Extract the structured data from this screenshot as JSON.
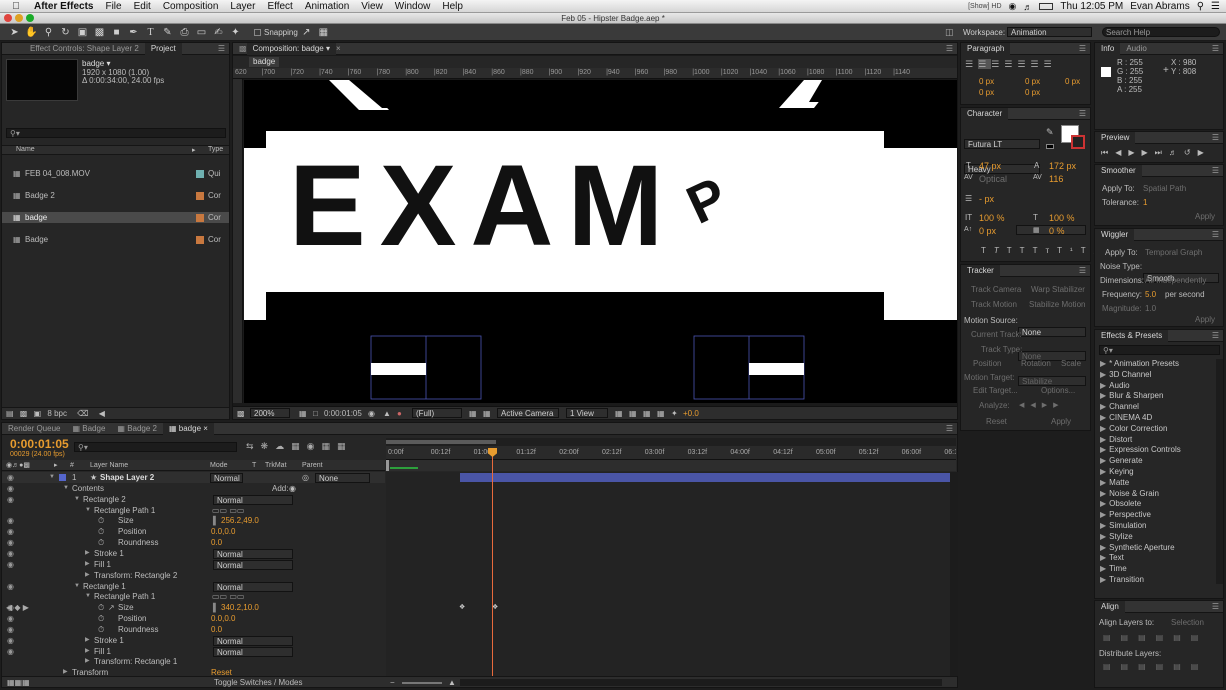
{
  "menubar": {
    "app_name": "After Effects",
    "items": [
      "File",
      "Edit",
      "Composition",
      "Layer",
      "Effect",
      "Animation",
      "View",
      "Window",
      "Help"
    ],
    "status_text": "[Show] HD",
    "clock": "Thu 12:05 PM",
    "user": "Evan Abrams"
  },
  "window_title": "Feb 05 - Hipster Badge.aep *",
  "toolbar": {
    "snapping_label": "Snapping",
    "workspace_label": "Workspace:",
    "workspace_value": "Animation",
    "search_placeholder": "Search Help"
  },
  "left_panel": {
    "tabs": [
      "Effect Controls: Shape Layer 2",
      "Project"
    ],
    "item_name": "badge ▾",
    "item_dims": "1920 x 1080 (1.00)",
    "item_duration": "Δ 0:00:34:00, 24.00 fps",
    "col_name": "Name",
    "col_type": "Type",
    "items": [
      {
        "name": "FEB 04_008.MOV",
        "type": "Qui",
        "color": "#6fb0b0"
      },
      {
        "name": "Badge 2",
        "type": "Cor",
        "color": "#c8783f"
      },
      {
        "name": "badge",
        "type": "Cor",
        "color": "#c8783f"
      },
      {
        "name": "Badge",
        "type": "Cor",
        "color": "#c8783f"
      }
    ],
    "footer_bpc": "8 bpc"
  },
  "comp_panel": {
    "tab": "Composition: badge",
    "subtab": "badge",
    "ruler_ticks": [
      "620",
      "|700",
      "|720",
      "|740",
      "|760",
      "|780",
      "|800",
      "|820",
      "|840",
      "|860",
      "|880",
      "|900",
      "|920",
      "|940",
      "|960",
      "|980",
      "|1000",
      "|1020",
      "|1040",
      "|1060",
      "|1080",
      "|1100",
      "|1120",
      "|1140"
    ],
    "badge_text": "EXAM",
    "badge_tail": "P",
    "zoom": "200%",
    "timecode": "0:00:01:05",
    "resolution": "(Full)",
    "camera": "Active Camera",
    "view": "1 View",
    "exposure": "+0.0"
  },
  "paragraph": {
    "tab": "Paragraph",
    "vals": [
      "0 px",
      "0 px",
      "0 px",
      "0 px",
      "0 px"
    ]
  },
  "character": {
    "tab": "Character",
    "font": "Futura LT",
    "style": "Heavy",
    "size": "47 px",
    "leading": "172 px",
    "kerning": "Optical",
    "tracking": "116",
    "stroke": "- px",
    "vscale": "100 %",
    "hscale": "100 %",
    "baseline": "0 px",
    "tsume": "0 %"
  },
  "tracker": {
    "tab": "Tracker",
    "track_camera": "Track Camera",
    "warp_stabilizer": "Warp Stabilizer",
    "track_motion": "Track Motion",
    "stabilize_motion": "Stabilize Motion",
    "motion_source_label": "Motion Source:",
    "motion_source": "None",
    "current_track_label": "Current Track:",
    "current_track": "None",
    "track_type_label": "Track Type:",
    "track_type": "Stabilize",
    "position": "Position",
    "rotation": "Rotation",
    "scale": "Scale",
    "motion_target": "Motion Target:",
    "edit_target": "Edit Target...",
    "options": "Options...",
    "analyze": "Analyze:",
    "reset": "Reset",
    "apply": "Apply"
  },
  "info": {
    "tabs": [
      "Info",
      "Audio"
    ],
    "r": "R : 255",
    "g": "G : 255",
    "b": "B : 255",
    "a": "A : 255",
    "x": "X : 980",
    "y": "Y : 808"
  },
  "preview": {
    "tab": "Preview"
  },
  "smoother": {
    "tab": "Smoother",
    "apply_to_label": "Apply To:",
    "apply_to": "Spatial Path",
    "tolerance_label": "Tolerance:",
    "tolerance": "1",
    "apply": "Apply"
  },
  "wiggler": {
    "tab": "Wiggler",
    "apply_to_label": "Apply To:",
    "apply_to": "Temporal Graph",
    "noise_label": "Noise Type:",
    "noise": "Smooth",
    "dim_label": "Dimensions:",
    "dim": "All Independently",
    "freq_label": "Frequency:",
    "freq": "5.0",
    "freq_unit": "per second",
    "mag_label": "Magnitude:",
    "mag": "1.0",
    "apply": "Apply"
  },
  "effects": {
    "tab": "Effects & Presets",
    "items": [
      "* Animation Presets",
      "3D Channel",
      "Audio",
      "Blur & Sharpen",
      "Channel",
      "CINEMA 4D",
      "Color Correction",
      "Distort",
      "Expression Controls",
      "Generate",
      "Keying",
      "Matte",
      "Noise & Grain",
      "Obsolete",
      "Perspective",
      "Simulation",
      "Stylize",
      "Synthetic Aperture",
      "Text",
      "Time",
      "Transition"
    ]
  },
  "align": {
    "tab": "Align",
    "align_to_label": "Align Layers to:",
    "align_to": "Selection",
    "distribute": "Distribute Layers:"
  },
  "timeline": {
    "tabs": [
      "Render Queue",
      "Badge",
      "Badge 2",
      "badge"
    ],
    "timecode": "0:00:01:05",
    "frames": "00029 (24.00 fps)",
    "col_layer": "Layer Name",
    "col_mode": "Mode",
    "col_t": "T",
    "col_trkmat": "TrkMat",
    "col_parent": "Parent",
    "ruler": [
      "0:00f",
      "00:12f",
      "01:00f",
      "01:12f",
      "02:00f",
      "02:12f",
      "03:00f",
      "03:12f",
      "04:00f",
      "04:12f",
      "05:00f",
      "05:12f",
      "06:00f",
      "06:1"
    ],
    "add_label": "Add:",
    "footer": "Toggle Switches / Modes",
    "rows": [
      {
        "indent": 0,
        "tri": "▼",
        "num": "1",
        "star": "★",
        "label": "Shape Layer 2",
        "mode": "Normal",
        "parent": "None",
        "bold": true
      },
      {
        "indent": 1,
        "tri": "▼",
        "label": "Contents",
        "add": true
      },
      {
        "indent": 2,
        "tri": "▼",
        "label": "Rectangle 2",
        "mode": "Normal"
      },
      {
        "indent": 3,
        "tri": "▼",
        "label": "Rectangle Path 1",
        "icons": true
      },
      {
        "indent": 4,
        "stop": true,
        "label": "Size",
        "value": "256.2,49.0",
        "link": true
      },
      {
        "indent": 4,
        "stop": true,
        "label": "Position",
        "value": "0.0,0.0"
      },
      {
        "indent": 4,
        "stop": true,
        "label": "Roundness",
        "value": "0.0"
      },
      {
        "indent": 3,
        "tri": "▶",
        "label": "Stroke 1",
        "mode": "Normal"
      },
      {
        "indent": 3,
        "tri": "▶",
        "label": "Fill 1",
        "mode": "Normal"
      },
      {
        "indent": 3,
        "tri": "▶",
        "label": "Transform: Rectangle 2"
      },
      {
        "indent": 2,
        "tri": "▼",
        "label": "Rectangle 1",
        "mode": "Normal"
      },
      {
        "indent": 3,
        "tri": "▼",
        "label": "Rectangle Path 1",
        "icons": true
      },
      {
        "indent": 4,
        "stop": true,
        "graph": true,
        "label": "Size",
        "value": "340.2,10.0",
        "link": true,
        "key": true
      },
      {
        "indent": 4,
        "stop": true,
        "label": "Position",
        "value": "0.0,0.0"
      },
      {
        "indent": 4,
        "stop": true,
        "label": "Roundness",
        "value": "0.0"
      },
      {
        "indent": 3,
        "tri": "▶",
        "label": "Stroke 1",
        "mode": "Normal"
      },
      {
        "indent": 3,
        "tri": "▶",
        "label": "Fill 1",
        "mode": "Normal"
      },
      {
        "indent": 3,
        "tri": "▶",
        "label": "Transform: Rectangle 1"
      },
      {
        "indent": 1,
        "tri": "▶",
        "label": "Transform",
        "reset": "Reset"
      }
    ]
  }
}
